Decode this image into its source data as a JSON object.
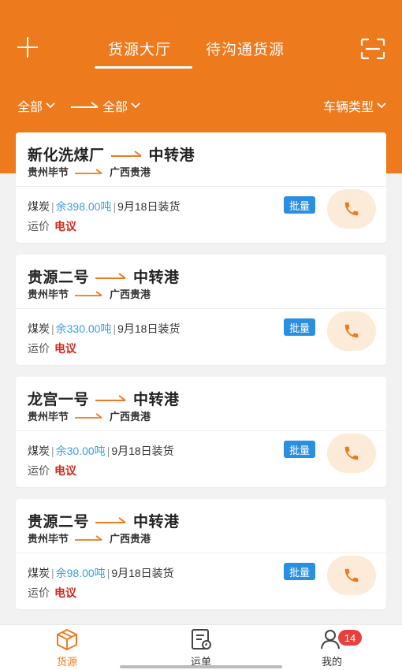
{
  "header": {
    "tabs": [
      {
        "label": "货源大厅",
        "active": true
      },
      {
        "label": "待沟通货源",
        "active": false
      }
    ],
    "accent_color": "#ee7a1e"
  },
  "filters": {
    "from": "全部",
    "to": "全部",
    "vehicle_type": "车辆类型"
  },
  "listings": [
    {
      "from": "新化洗煤厂",
      "to": "中转港",
      "from_region": "贵州毕节",
      "to_region": "广西贵港",
      "goods": "煤炭",
      "remaining": "余398.00吨",
      "load_date": "9月18日装货",
      "price_label": "运价",
      "price": "电议",
      "badge": "批量"
    },
    {
      "from": "贵源二号",
      "to": "中转港",
      "from_region": "贵州毕节",
      "to_region": "广西贵港",
      "goods": "煤炭",
      "remaining": "余330.00吨",
      "load_date": "9月18日装货",
      "price_label": "运价",
      "price": "电议",
      "badge": "批量"
    },
    {
      "from": "龙宫一号",
      "to": "中转港",
      "from_region": "贵州毕节",
      "to_region": "广西贵港",
      "goods": "煤炭",
      "remaining": "余30.00吨",
      "load_date": "9月18日装货",
      "price_label": "运价",
      "price": "电议",
      "badge": "批量"
    },
    {
      "from": "贵源二号",
      "to": "中转港",
      "from_region": "贵州毕节",
      "to_region": "广西贵港",
      "goods": "煤炭",
      "remaining": "余98.00吨",
      "load_date": "9月18日装货",
      "price_label": "运价",
      "price": "电议",
      "badge": "批量"
    }
  ],
  "tabbar": {
    "items": [
      {
        "label": "货源",
        "icon": "box-icon",
        "active": true
      },
      {
        "label": "运单",
        "icon": "waybill-icon",
        "active": false
      },
      {
        "label": "我的",
        "icon": "user-icon",
        "active": false,
        "badge": "14"
      }
    ]
  }
}
